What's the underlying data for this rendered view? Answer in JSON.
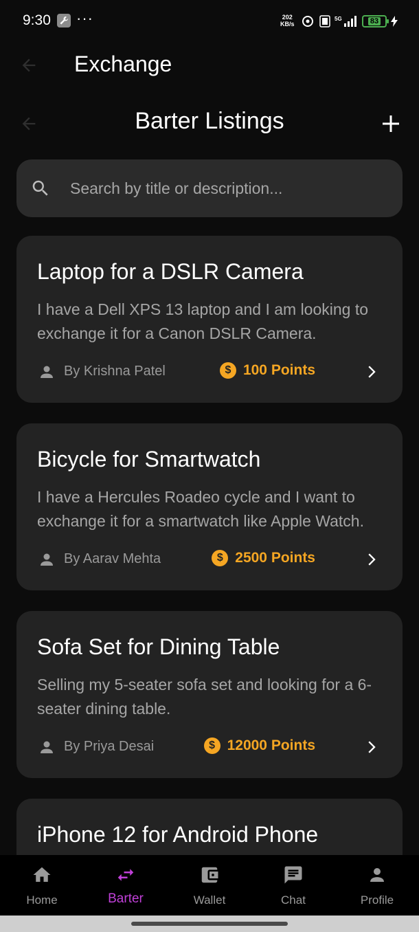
{
  "status_bar": {
    "time": "9:30",
    "more": "···",
    "net_speed_value": "202",
    "net_speed_unit": "KB/s",
    "battery": "83"
  },
  "top_bar": {
    "title": "Exchange"
  },
  "page": {
    "title": "Barter Listings"
  },
  "search": {
    "placeholder": "Search by title or description..."
  },
  "listings": [
    {
      "title": "Laptop for a DSLR Camera",
      "description": "I have a Dell XPS 13 laptop and I am looking to exchange it for a Canon DSLR Camera.",
      "author": "By Krishna Patel",
      "points": "100 Points"
    },
    {
      "title": "Bicycle for Smartwatch",
      "description": "I have a Hercules Roadeo cycle and I want to exchange it for a smartwatch like Apple Watch.",
      "author": "By Aarav Mehta",
      "points": "2500 Points"
    },
    {
      "title": "Sofa Set for Dining Table",
      "description": "Selling my 5-seater sofa set and looking for a 6-seater dining table.",
      "author": "By Priya Desai",
      "points": "12000 Points"
    },
    {
      "title": "iPhone 12 for Android Phone"
    }
  ],
  "coin_symbol": "$",
  "bottom_nav": [
    {
      "label": "Home",
      "icon": "home-icon"
    },
    {
      "label": "Barter",
      "icon": "swap-icon",
      "active": true
    },
    {
      "label": "Wallet",
      "icon": "wallet-icon"
    },
    {
      "label": "Chat",
      "icon": "chat-icon"
    },
    {
      "label": "Profile",
      "icon": "person-icon"
    }
  ],
  "colors": {
    "background": "#0c0c0c",
    "card": "#232323",
    "search": "#2b2b2b",
    "points": "#f5a623",
    "active_nav": "#c040d8",
    "battery": "#4caf50"
  }
}
